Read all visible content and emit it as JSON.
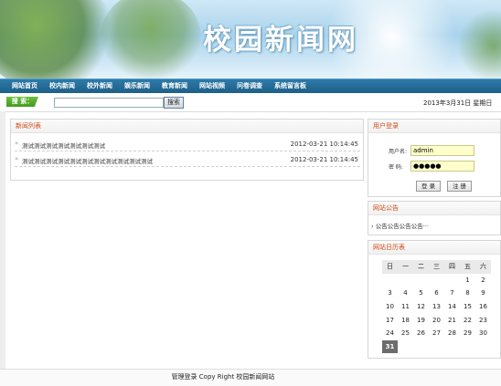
{
  "banner": {
    "site_title": "校园新闻网"
  },
  "nav": {
    "items": [
      "网站首页",
      "校内新闻",
      "校外新闻",
      "娱乐新闻",
      "教育新闻",
      "网站视频",
      "问卷调查",
      "系统留言板"
    ]
  },
  "search": {
    "label": "搜 索：",
    "value": "",
    "button_label": "搜索"
  },
  "date": {
    "text": "2013年3月31日 星期日"
  },
  "news": {
    "title": "新闻列表",
    "rows": [
      {
        "title": "测试测试测试测试测试测试测试",
        "time": "2012-03-21 10:14:45"
      },
      {
        "title": "测试测试测试测试测试测试测试测试测试测试测试",
        "time": "2012-03-21 10:14:45"
      }
    ]
  },
  "login": {
    "title": "用户登录",
    "username_label": "用户名:",
    "username_value": "admin",
    "password_label": "密 码:",
    "password_value": "●●●●●",
    "login_button": "登 录",
    "register_button": "注 册"
  },
  "notice": {
    "title": "网站公告",
    "text": "公告公告公告公告···"
  },
  "calendar": {
    "title": "网站日历表",
    "weekdays": [
      "日",
      "一",
      "二",
      "三",
      "四",
      "五",
      "六"
    ],
    "weeks": [
      [
        "",
        "",
        "",
        "",
        "",
        "1",
        "2"
      ],
      [
        "3",
        "4",
        "5",
        "6",
        "7",
        "8",
        "9"
      ],
      [
        "10",
        "11",
        "12",
        "13",
        "14",
        "15",
        "16"
      ],
      [
        "17",
        "18",
        "19",
        "20",
        "21",
        "22",
        "23"
      ],
      [
        "24",
        "25",
        "26",
        "27",
        "28",
        "29",
        "30"
      ],
      [
        "31",
        "",
        "",
        "",
        "",
        "",
        ""
      ]
    ],
    "today": "31"
  },
  "footer": {
    "text": "管理登录  Copy Right 校园新闻网站"
  },
  "colors": {
    "nav": "#1e5f88",
    "accent": "#d04a14",
    "search_tag": "#4da525",
    "input_bg": "#ffffcc"
  }
}
